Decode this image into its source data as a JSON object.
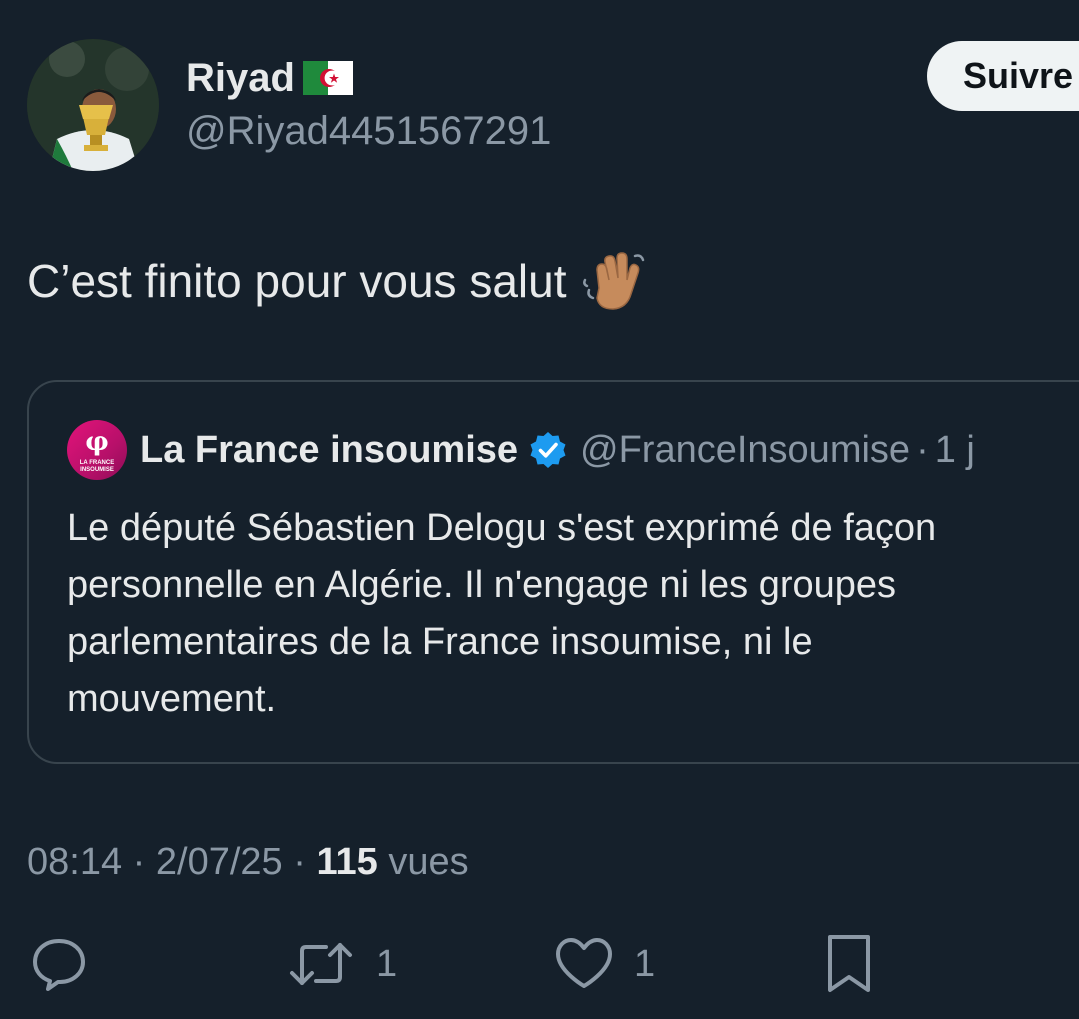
{
  "author": {
    "display_name": "Riyad",
    "flag": "Algeria flag",
    "handle": "@Riyad4451567291",
    "avatar": "profile-photo"
  },
  "follow_button": {
    "label": "Suivre"
  },
  "tweet": {
    "text": "C’est finito pour vous salut",
    "emoji": "waving-hand"
  },
  "quote": {
    "name": "La France insoumise",
    "handle": "@FranceInsoumise",
    "separator": "·",
    "time": "1 j",
    "body": "Le député Sébastien Delogu s'est exprimé de façon\npersonnelle en Algérie. Il n'engage ni les groupes\nparlementaires de la France insoumise, ni le\nmouvement.",
    "logo_text": "LA FRANCE INSOUMISE",
    "accent": "#e3137a"
  },
  "meta": {
    "time": "08:14",
    "sep1": " · ",
    "date": "2/07/25",
    "sep2": " · ",
    "views_count": "115",
    "views_label": " vues"
  },
  "actions": {
    "reply": {
      "icon": "reply-icon",
      "count": ""
    },
    "retweet": {
      "icon": "retweet-icon",
      "count": "1"
    },
    "like": {
      "icon": "heart-icon",
      "count": "1"
    },
    "bookmark": {
      "icon": "bookmark-icon",
      "count": ""
    }
  },
  "colors": {
    "background": "#15202b",
    "text": "#e7e9ea",
    "secondary": "#8b98a5",
    "border": "#38444d",
    "verified": "#1d9bf0"
  }
}
